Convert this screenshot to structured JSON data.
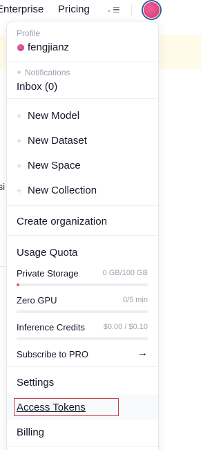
{
  "topnav": {
    "enterprise_label": "Enterprise",
    "pricing_label": "Pricing",
    "more_icon": "chevron-list-icon"
  },
  "background": {
    "partial_text": "si"
  },
  "menu": {
    "profile": {
      "heading": "Profile",
      "username": "fengjianz"
    },
    "notifications": {
      "heading": "Notifications",
      "inbox": "Inbox (0)"
    },
    "create": [
      {
        "label": "New Model"
      },
      {
        "label": "New Dataset"
      },
      {
        "label": "New Space"
      },
      {
        "label": "New Collection"
      }
    ],
    "create_org": "Create organization",
    "usage": {
      "heading": "Usage Quota",
      "private_storage": {
        "label": "Private Storage",
        "value": "0 GB/100 GB",
        "fraction": 0.01
      },
      "zero_gpu": {
        "label": "Zero GPU",
        "value": "0/5 min",
        "fraction": 0
      },
      "inference": {
        "label": "Inference Credits",
        "value": "$0.00 / $0.10",
        "fraction": 0
      },
      "subscribe": "Subscribe to PRO",
      "subscribe_arrow": "→"
    },
    "settings": "Settings",
    "access_tokens": "Access Tokens",
    "billing": "Billing"
  },
  "colors": {
    "avatar_gradient": "#e0477e",
    "storage_fill": "#e35a6a",
    "highlight_border": "#c0444a"
  }
}
